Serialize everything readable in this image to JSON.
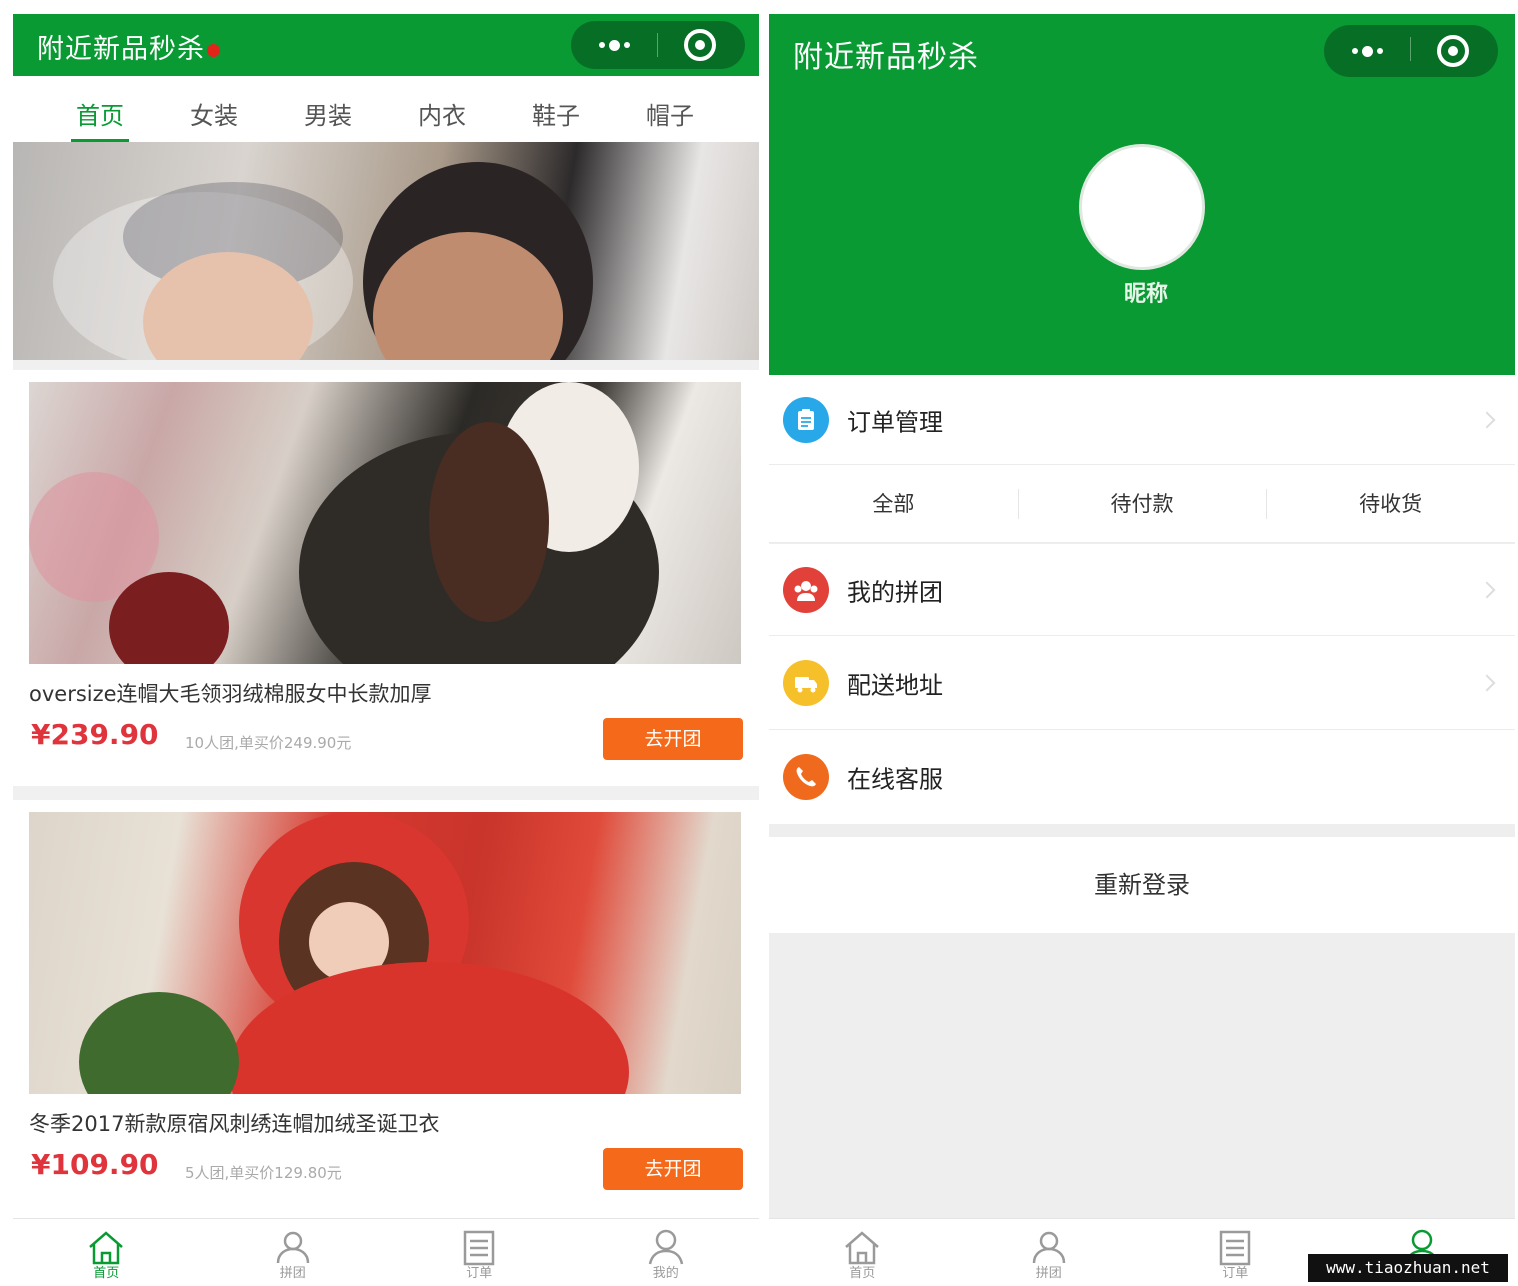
{
  "left": {
    "header": {
      "title": "附近新品秒杀"
    },
    "tabs": [
      "首页",
      "女装",
      "男装",
      "内衣",
      "鞋子",
      "帽子"
    ],
    "products": [
      {
        "title": "oversize连帽大毛领羽绒棉服女中长款加厚",
        "price": "¥239.90",
        "note": "10人团,单买价249.90元",
        "button": "去开团"
      },
      {
        "title": "冬季2017新款原宿风刺绣连帽加绒圣诞卫衣",
        "price": "¥109.90",
        "note": "5人团,单买价129.80元",
        "button": "去开团"
      }
    ],
    "tabbar": [
      "首页",
      "拼团",
      "订单",
      "我的"
    ]
  },
  "right": {
    "header": {
      "title": "附近新品秒杀"
    },
    "profile": {
      "username": "昵称"
    },
    "menu": {
      "orders": {
        "label": "订单管理",
        "tabs": [
          "全部",
          "待付款",
          "待收货"
        ]
      },
      "group": {
        "label": "我的拼团"
      },
      "address": {
        "label": "配送地址"
      },
      "service": {
        "label": "在线客服"
      }
    },
    "relogin": "重新登录",
    "tabbar": [
      "首页",
      "拼团",
      "订单",
      "我的"
    ]
  },
  "watermark": "www.tiaozhuan.net",
  "colors": {
    "brand": "#0a9a34",
    "price": "#e0343d",
    "button": "#f46a1a"
  }
}
